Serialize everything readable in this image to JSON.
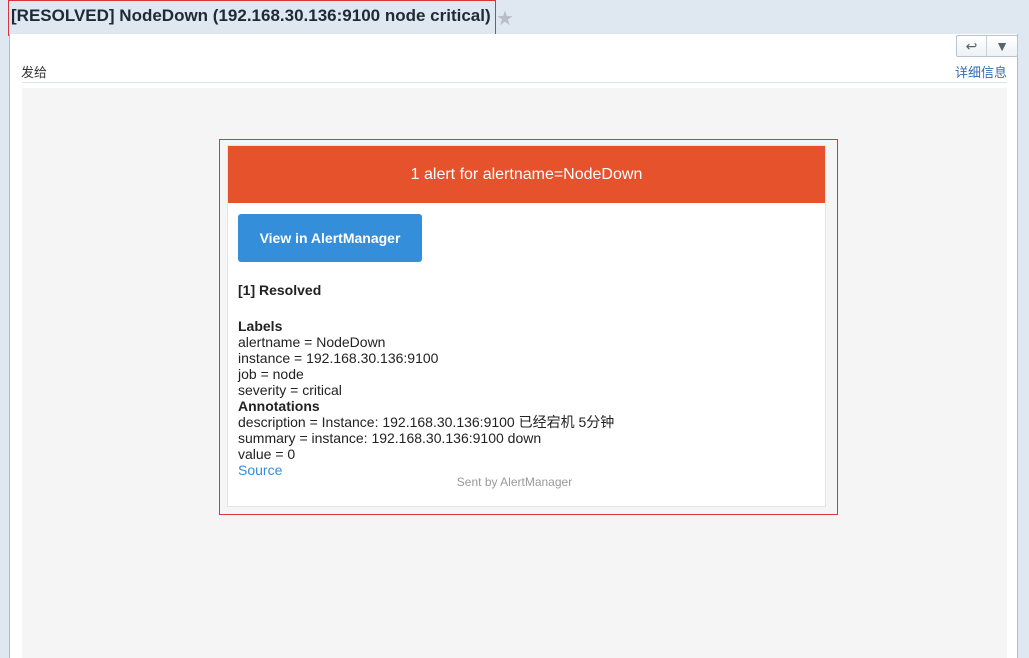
{
  "subject": {
    "title": "[RESOLVED] NodeDown (192.168.30.136:9100 node critical)",
    "star_icon": "star-icon"
  },
  "toolbar": {
    "reply_icon": "reply-icon",
    "more_icon": "chevron-down-icon"
  },
  "message_header": {
    "from_label": "发给",
    "details_link": "详细信息"
  },
  "email": {
    "header_text": "1 alert for alertname=NodeDown",
    "button_label": "View in AlertManager",
    "resolved_heading": "[1] Resolved",
    "labels_heading": "Labels",
    "labels": [
      "alertname = NodeDown",
      "instance = 192.168.30.136:9100",
      "job = node",
      "severity = critical"
    ],
    "annotations_heading": "Annotations",
    "annotations": [
      "description = Instance: 192.168.30.136:9100 已经宕机 5分钟",
      "summary = instance: 192.168.30.136:9100 down",
      "value = 0"
    ],
    "source_link": "Source",
    "footer": "Sent by AlertManager"
  },
  "colors": {
    "header": "#e6522c",
    "button": "#348eda",
    "highlight_box": "#db3939"
  }
}
